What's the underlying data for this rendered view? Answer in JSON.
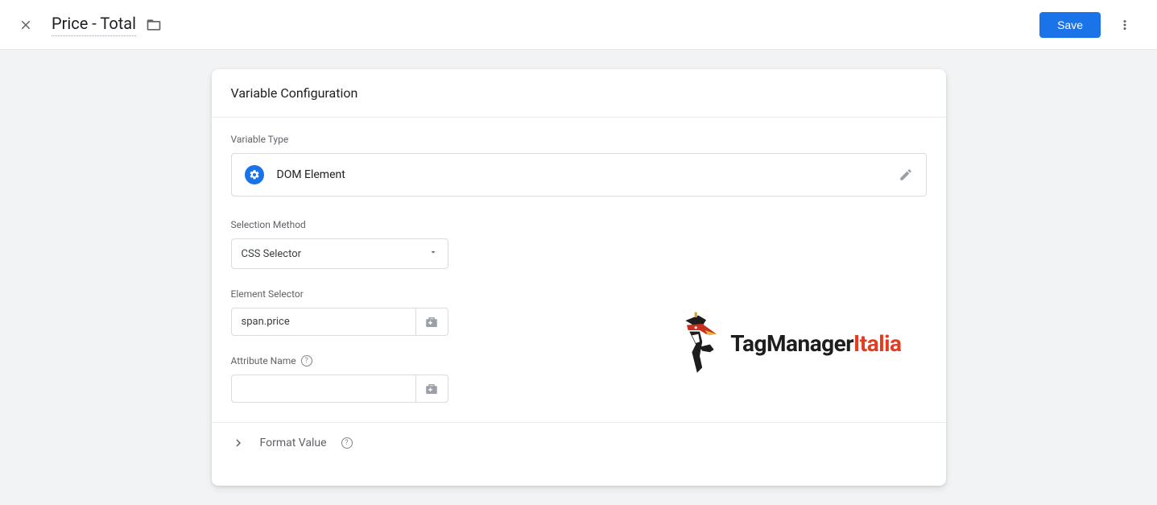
{
  "header": {
    "title": "Price - Total",
    "save_label": "Save"
  },
  "card": {
    "title": "Variable Configuration",
    "type_label": "Variable Type",
    "type_value": "DOM Element",
    "selection_method_label": "Selection Method",
    "selection_method_value": "CSS Selector",
    "element_selector_label": "Element Selector",
    "element_selector_value": "span.price",
    "attribute_name_label": "Attribute Name",
    "attribute_name_value": "",
    "format_value_label": "Format Value"
  },
  "watermark": {
    "text_a": "TagManager",
    "text_b": "Italia"
  }
}
